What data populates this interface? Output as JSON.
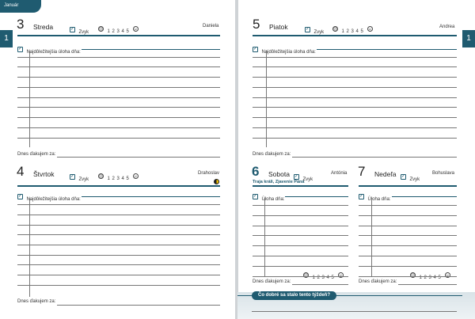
{
  "header": {
    "month": "Január",
    "left_tab": "1",
    "right_tab": "1"
  },
  "labels": {
    "habit": "Zvyk",
    "scale": "1 2 3 4 5",
    "task_long": "Najdôležitejšia úloha dňa:",
    "task_short": "Úloha dňa:",
    "thanks": "Dnes ďakujem za:"
  },
  "days": {
    "d3": {
      "num": "3",
      "name": "Streda",
      "nameday": "Daniela"
    },
    "d4": {
      "num": "4",
      "name": "Štvrtok",
      "nameday": "Drahoslav"
    },
    "d5": {
      "num": "5",
      "name": "Piatok",
      "nameday": "Andrea"
    },
    "d6": {
      "num": "6",
      "name": "Sobota",
      "nameday": "Antónia",
      "holiday": "Traja králi, Zjavenie Pána"
    },
    "d7": {
      "num": "7",
      "name": "Nedeľa",
      "nameday": "Bohuslava"
    }
  },
  "footer": {
    "question": "Čo dobré sa stalo tento týždeň?"
  },
  "colors": {
    "accent": "#1f5b70",
    "moon_dark": "#222222",
    "moon_light": "#f2c200"
  },
  "icons": {
    "check": "checkbox-icon",
    "face": "smiley-icon",
    "moon": "moon-phase-icon"
  }
}
